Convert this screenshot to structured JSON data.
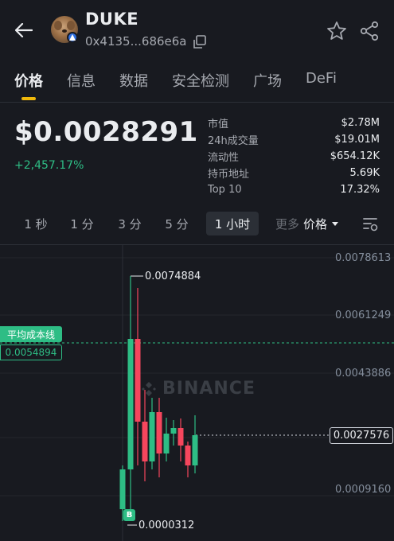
{
  "header": {
    "token_name": "DUKE",
    "address": "0x4135...686e6a",
    "avatar_icon": "dog-avatar-icon"
  },
  "tabs": [
    {
      "label": "价格",
      "active": true
    },
    {
      "label": "信息",
      "active": false
    },
    {
      "label": "数据",
      "active": false
    },
    {
      "label": "安全检测",
      "active": false
    },
    {
      "label": "广场",
      "active": false
    },
    {
      "label": "DeFi",
      "active": false
    }
  ],
  "price": {
    "value": "$0.0028291",
    "change": "+2,457.17%"
  },
  "stats": [
    {
      "label": "市值",
      "value": "$2.78M"
    },
    {
      "label": "24h成交量",
      "value": "$19.01M"
    },
    {
      "label": "流动性",
      "value": "$654.12K"
    },
    {
      "label": "持币地址",
      "value": "5.69K"
    },
    {
      "label": "Top 10",
      "value": "17.32%"
    }
  ],
  "intervals": {
    "items": [
      "1 秒",
      "1 分",
      "3 分",
      "5 分",
      "1 小时"
    ],
    "active": "1 小时",
    "more_label": "更多",
    "chart_type_label": "价格"
  },
  "chart": {
    "y_ticks": [
      "0.0078613",
      "0.0061249",
      "0.0043886",
      "0.0027576",
      "0.0009160"
    ],
    "high_label": "0.0074884",
    "low_label": "0.0000312",
    "avg_cost_label": "平均成本线",
    "avg_cost_value": "0.0054894",
    "current_value": "0.0027576",
    "buy_marker": "B",
    "watermark": "BINANCE"
  },
  "colors": {
    "background": "#181a20",
    "up": "#2ebd85",
    "down": "#f6465d",
    "accent": "#f0b90b"
  }
}
